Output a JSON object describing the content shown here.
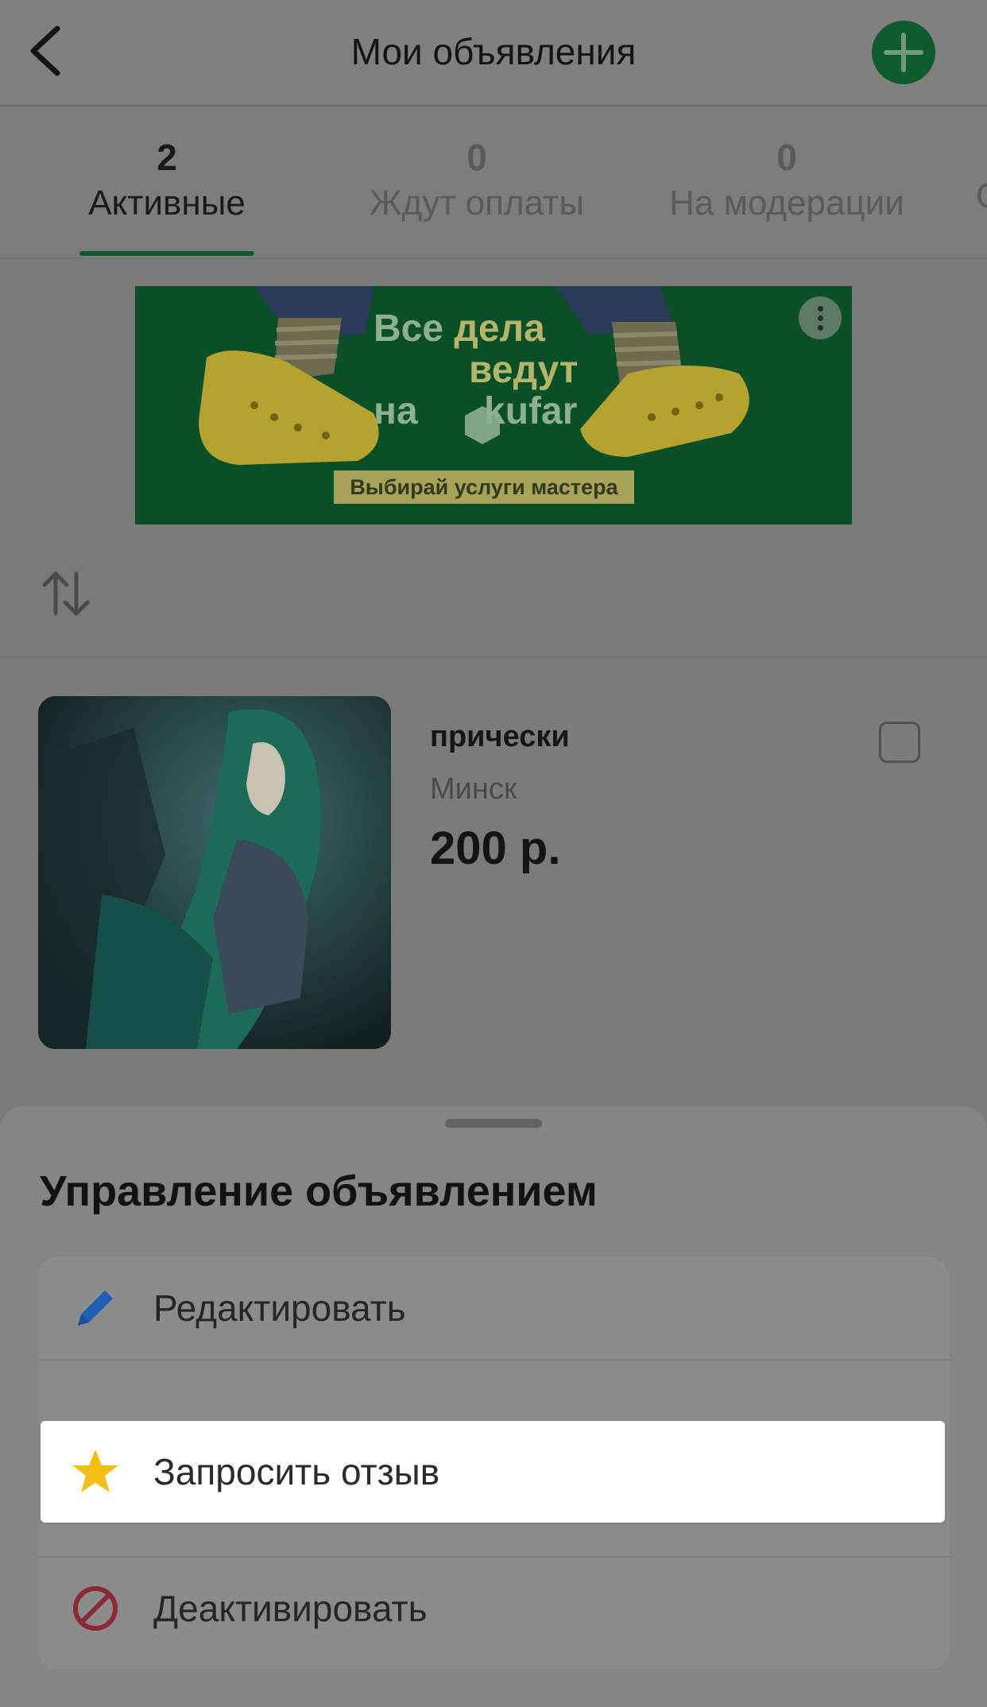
{
  "header": {
    "title": "Мои объявления"
  },
  "tabs": [
    {
      "count": "2",
      "label": "Активные",
      "active": true
    },
    {
      "count": "0",
      "label": "Ждут оплаты",
      "active": false
    },
    {
      "count": "0",
      "label": "На модерации",
      "active": false
    }
  ],
  "tab_partial": "О",
  "banner": {
    "line1": "Все",
    "line1b": "дела",
    "line2": "ведут",
    "line3": "на",
    "brand": "kufar",
    "cta": "Выбирай услуги мастера"
  },
  "listing": {
    "title": "прически",
    "city": "Минск",
    "price": "200 р."
  },
  "sheet": {
    "title": "Управление объявлением",
    "items": [
      {
        "label": "Редактировать",
        "icon": "pencil-icon"
      },
      {
        "label": "Запросить отзыв",
        "icon": "star-icon"
      },
      {
        "label": "Деактивировать",
        "icon": "prohibited-icon"
      }
    ]
  },
  "colors": {
    "brand_green": "#0e5c2e",
    "pencil_blue": "#1f5fb3",
    "star_yellow": "#f3bf16",
    "deactivate_red": "#8a2a33"
  }
}
